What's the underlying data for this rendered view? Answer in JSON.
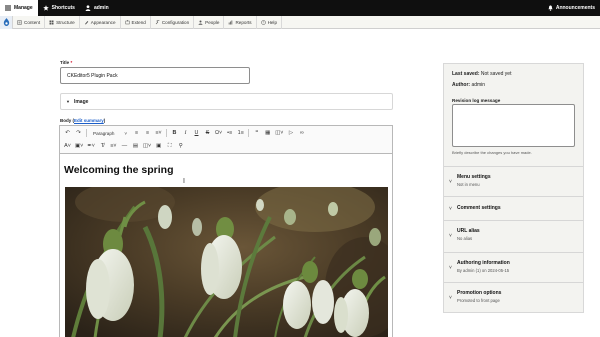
{
  "toolbar": {
    "manage": "Manage",
    "shortcuts": "Shortcuts",
    "user": "admin",
    "announcements": "Announcements"
  },
  "admin_menu": [
    {
      "label": "Content",
      "icon": "content-icon"
    },
    {
      "label": "Structure",
      "icon": "structure-icon"
    },
    {
      "label": "Appearance",
      "icon": "appearance-icon"
    },
    {
      "label": "Extend",
      "icon": "extend-icon"
    },
    {
      "label": "Configuration",
      "icon": "configuration-icon"
    },
    {
      "label": "People",
      "icon": "people-icon"
    },
    {
      "label": "Reports",
      "icon": "reports-icon"
    },
    {
      "label": "Help",
      "icon": "help-icon"
    }
  ],
  "form": {
    "title_label": "Title",
    "title_value": "CKEditor5 Plugin Pack",
    "image_label": "Image",
    "body_label": "Body",
    "edit_summary": "Edit summary",
    "editor": {
      "heading_dropdown": "Paragraph",
      "content_heading": "Welcoming the spring"
    }
  },
  "sidebar": {
    "last_saved_label": "Last saved:",
    "last_saved_value": "Not saved yet",
    "author_label": "Author:",
    "author_value": "admin",
    "revision_label": "Revision log message",
    "revision_help": "Briefly describe the changes you have made.",
    "sections": [
      {
        "title": "Menu settings",
        "summary": "Not in menu"
      },
      {
        "title": "Comment settings",
        "summary": ""
      },
      {
        "title": "URL alias",
        "summary": "No alias"
      },
      {
        "title": "Authoring information",
        "summary": "By admin (1) on 2024-05-15"
      },
      {
        "title": "Promotion options",
        "summary": "Promoted to front page"
      }
    ]
  },
  "colors": {
    "topbar": "#0f0f0f",
    "link": "#1b5ec9",
    "required": "#d0021b"
  }
}
